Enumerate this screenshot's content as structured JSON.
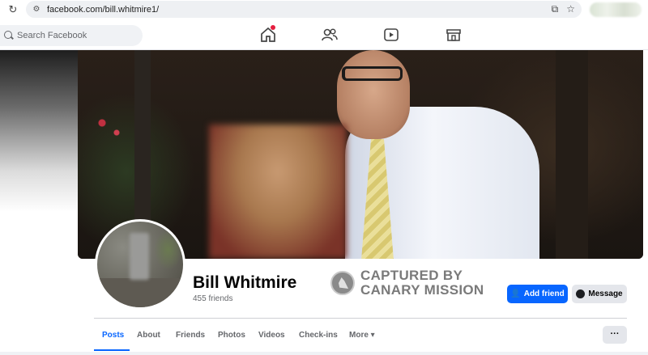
{
  "browser": {
    "url": "facebook.com/bill.whitmire1/"
  },
  "nav": {
    "search_placeholder": "Search Facebook"
  },
  "profile": {
    "name": "Bill Whitmire",
    "friends": "455 friends"
  },
  "watermark": {
    "line1": "CAPTURED BY",
    "line2": "CANARY MISSION"
  },
  "actions": {
    "add_friend": "Add friend",
    "message": "Message",
    "more_dots": "···"
  },
  "tabs": [
    {
      "label": "Posts"
    },
    {
      "label": "About"
    },
    {
      "label": "Friends"
    },
    {
      "label": "Photos"
    },
    {
      "label": "Videos"
    },
    {
      "label": "Check-ins"
    },
    {
      "label": "More ▾"
    }
  ],
  "colors": {
    "accent": "#0866ff",
    "notification": "#e41e3f"
  }
}
